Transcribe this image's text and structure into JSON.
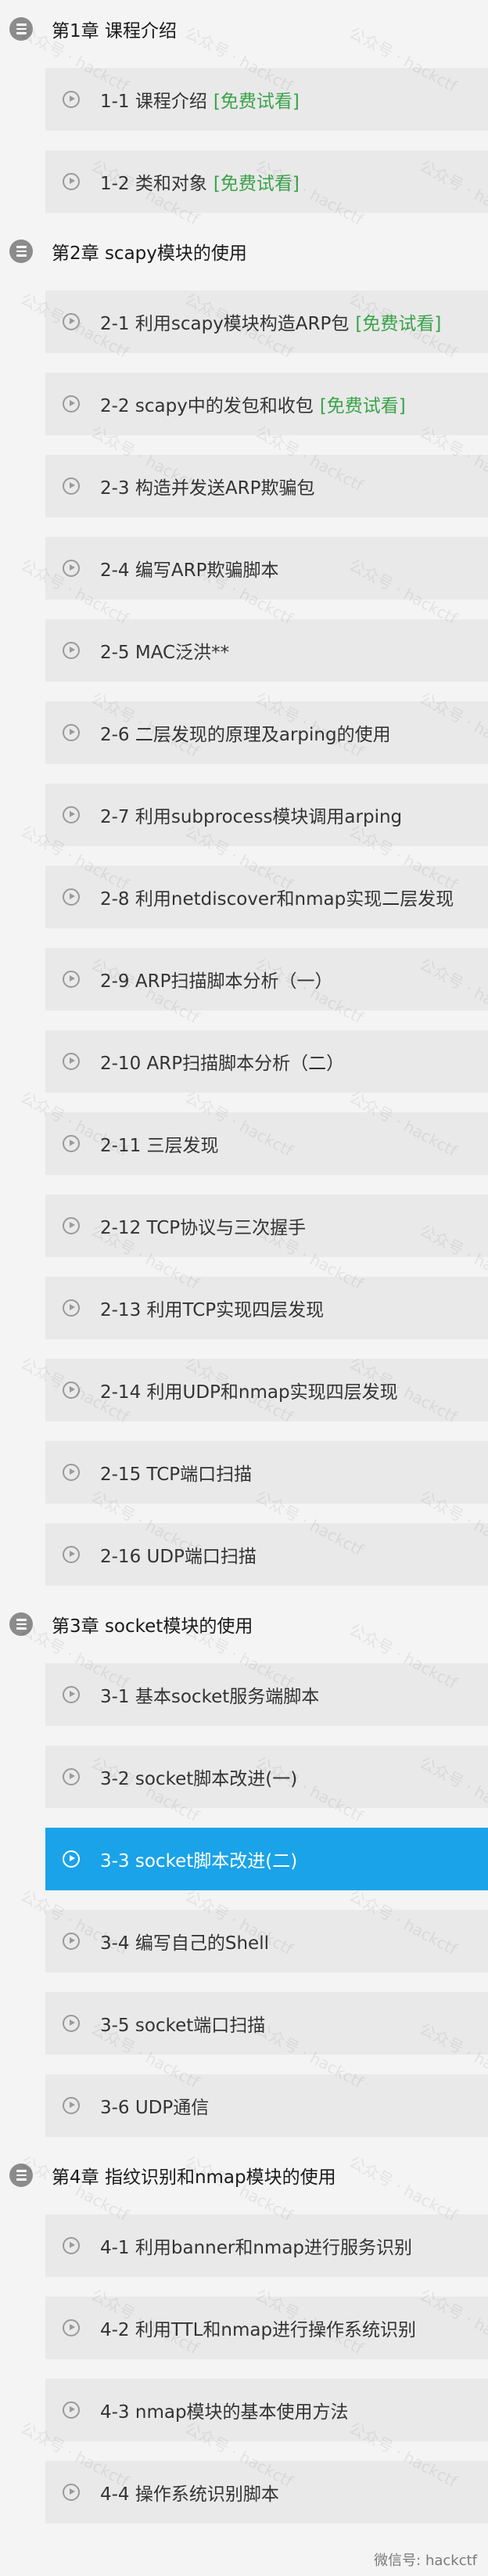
{
  "chapters": [
    {
      "title": "第1章 课程介绍",
      "lessons": [
        {
          "title": "1-1 课程介绍",
          "tag": "[免费试看]"
        },
        {
          "title": "1-2 类和对象",
          "tag": "[免费试看]"
        }
      ]
    },
    {
      "title": "第2章 scapy模块的使用",
      "lessons": [
        {
          "title": "2-1 利用scapy模块构造ARP包",
          "tag": "[免费试看]"
        },
        {
          "title": "2-2 scapy中的发包和收包",
          "tag": "[免费试看]"
        },
        {
          "title": "2-3 构造并发送ARP欺骗包"
        },
        {
          "title": "2-4 编写ARP欺骗脚本"
        },
        {
          "title": "2-5 MAC泛洪**"
        },
        {
          "title": "2-6 二层发现的原理及arping的使用"
        },
        {
          "title": "2-7 利用subprocess模块调用arping"
        },
        {
          "title": "2-8 利用netdiscover和nmap实现二层发现"
        },
        {
          "title": "2-9 ARP扫描脚本分析（一）"
        },
        {
          "title": "2-10 ARP扫描脚本分析（二）"
        },
        {
          "title": "2-11 三层发现"
        },
        {
          "title": "2-12 TCP协议与三次握手"
        },
        {
          "title": "2-13 利用TCP实现四层发现"
        },
        {
          "title": "2-14 利用UDP和nmap实现四层发现"
        },
        {
          "title": "2-15 TCP端口扫描"
        },
        {
          "title": "2-16 UDP端口扫描"
        }
      ]
    },
    {
      "title": "第3章 socket模块的使用",
      "lessons": [
        {
          "title": "3-1 基本socket服务端脚本"
        },
        {
          "title": "3-2 socket脚本改进(一)"
        },
        {
          "title": "3-3 socket脚本改进(二)",
          "active": true
        },
        {
          "title": "3-4 编写自己的Shell"
        },
        {
          "title": "3-5 socket端口扫描"
        },
        {
          "title": "3-6 UDP通信"
        }
      ]
    },
    {
      "title": "第4章 指纹识别和nmap模块的使用",
      "lessons": [
        {
          "title": "4-1 利用banner和nmap进行服务识别"
        },
        {
          "title": "4-2 利用TTL和nmap进行操作系统识别"
        },
        {
          "title": "4-3 nmap模块的基本使用方法"
        },
        {
          "title": "4-4 操作系统识别脚本"
        }
      ]
    }
  ],
  "icons": {
    "chapter": "list-icon",
    "lesson": "play-circle-icon"
  },
  "colors": {
    "active_bg": "#1aa3e8",
    "free_tag": "#3aa34a",
    "chapter_icon": "#8c8c8c"
  },
  "watermark": {
    "tile_text": "公众号 · hackctf",
    "footer_text": "微信号: hackctf"
  }
}
